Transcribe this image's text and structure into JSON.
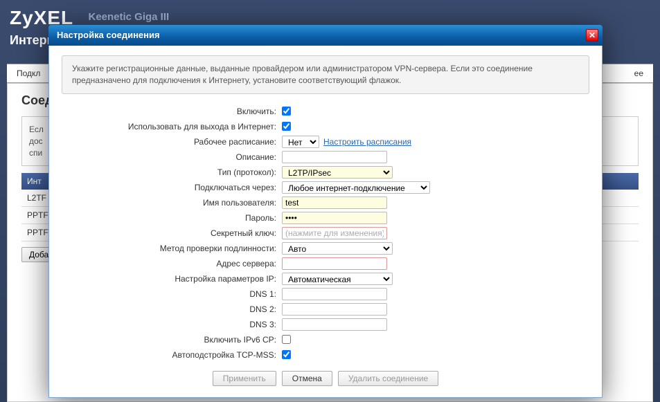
{
  "header": {
    "logo": "ZyXEL",
    "model": "Keenetic Giga III",
    "subtitle": "Интерн"
  },
  "tabs": {
    "left": "Подкл",
    "right": "ee"
  },
  "bg": {
    "section_title": "Соед",
    "box_lines": [
      "Есл",
      "дос",
      "спи"
    ],
    "table_header": "Инт",
    "rows": [
      "L2TF",
      "PPTF",
      "PPTF"
    ],
    "add_btn": "Доба"
  },
  "modal": {
    "title": "Настройка соединения",
    "close": "✕",
    "info": "Укажите регистрационные данные, выданные провайдером или администратором VPN-сервера. Если это соединение предназначено для подключения к Интернету, установите соответствующий флажок.",
    "labels": {
      "enable": "Включить:",
      "use_inet": "Использовать для выхода в Интернет:",
      "schedule": "Рабочее расписание:",
      "schedule_link": "Настроить расписания",
      "description": "Описание:",
      "protocol": "Тип (протокол):",
      "connect_via": "Подключаться через:",
      "username": "Имя пользователя:",
      "password": "Пароль:",
      "secret": "Секретный ключ:",
      "auth_method": "Метод проверки подлинности:",
      "server": "Адрес сервера:",
      "ip_params": "Настройка параметров IP:",
      "dns1": "DNS 1:",
      "dns2": "DNS 2:",
      "dns3": "DNS 3:",
      "ipv6cp": "Включить IPv6 CP:",
      "tcpmss": "Автоподстройка TCP-MSS:"
    },
    "values": {
      "schedule_opt": "Нет",
      "protocol_opt": "L2TP/IPsec",
      "connect_via_opt": "Любое интернет-подключение",
      "username": "test",
      "password": "••••",
      "secret_ph": "(нажмите для изменения)",
      "auth_opt": "Авто",
      "ip_params_opt": "Автоматическая"
    },
    "buttons": {
      "apply": "Применить",
      "cancel": "Отмена",
      "delete": "Удалить соединение"
    }
  }
}
